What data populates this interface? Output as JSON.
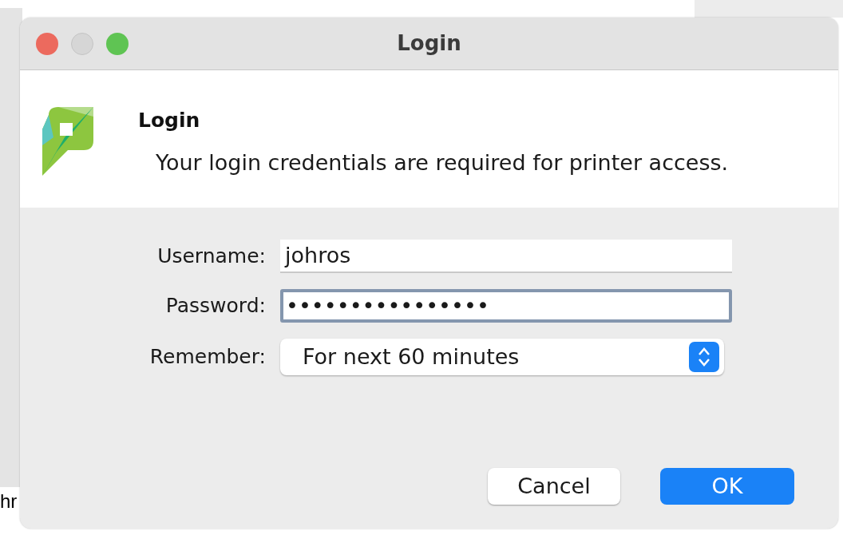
{
  "background": {
    "text_fragment": "hr"
  },
  "window": {
    "title": "Login"
  },
  "header": {
    "title": "Login",
    "message": "Your login credentials are required for printer access."
  },
  "fields": [
    {
      "kind": "text",
      "label": "Username:",
      "value": "johros",
      "focused": false
    },
    {
      "kind": "password",
      "label": "Password:",
      "value": "••••••••••••••••",
      "focused": true
    },
    {
      "kind": "select",
      "label": "Remember:",
      "value": "For next 60 minutes"
    }
  ],
  "buttons": [
    {
      "label": "Cancel",
      "default": false
    },
    {
      "label": "OK",
      "default": true
    }
  ]
}
